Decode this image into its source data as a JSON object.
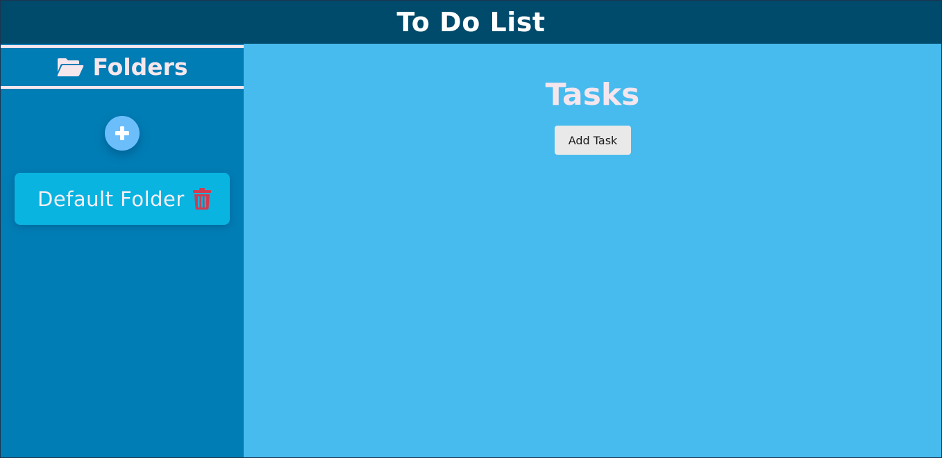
{
  "header": {
    "title": "To Do List"
  },
  "sidebar": {
    "title": "Folders",
    "title_icon": "folder-open-icon",
    "add_button_icon": "plus-icon",
    "folders": [
      {
        "name": "Default Folder",
        "delete_icon": "trash-icon"
      }
    ]
  },
  "main": {
    "title": "Tasks",
    "add_task_label": "Add Task"
  },
  "colors": {
    "header_bg": "#004a6b",
    "sidebar_bg": "#007db5",
    "main_bg": "#47bbee",
    "folder_card_bg": "#0ab4e0",
    "add_button_bg": "#6cbefb",
    "delete_icon": "#d33a4f",
    "heading_text": "#f5e6ee"
  }
}
